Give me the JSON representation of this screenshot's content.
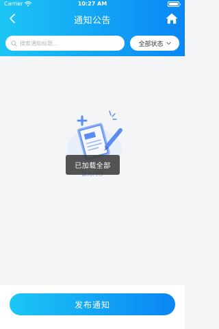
{
  "status_bar": {
    "carrier": "Carrier",
    "time": "10:27 AM"
  },
  "nav": {
    "title": "通知公告"
  },
  "search": {
    "placeholder": "搜索通知标题..."
  },
  "status_filter": {
    "selected": "全部状态"
  },
  "empty": {
    "text": "暂无内容"
  },
  "toast": {
    "text": "已加载全部"
  },
  "publish_button": {
    "label": "发布通知"
  },
  "colors": {
    "gradient_start": "#1cc6f5",
    "gradient_end": "#0a86f4",
    "background": "#f4f5f7"
  },
  "icons": {
    "back": "chevron-left-icon",
    "home": "home-icon",
    "search": "search-icon",
    "dropdown": "chevron-down-icon",
    "wifi": "wifi-icon",
    "battery": "battery-icon",
    "empty": "document-pen-illustration"
  }
}
